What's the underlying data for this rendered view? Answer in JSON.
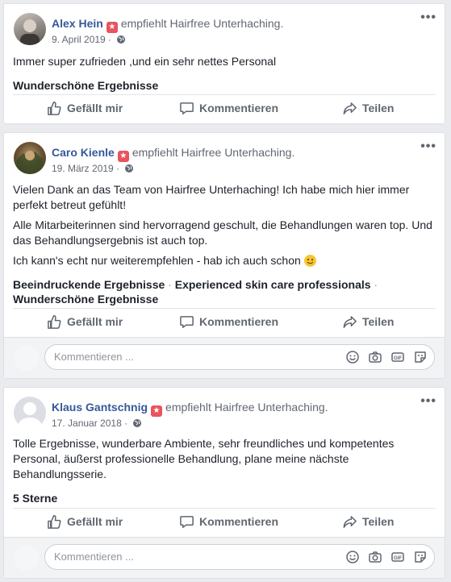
{
  "common": {
    "like_label": "Gefällt mir",
    "comment_label": "Kommentieren",
    "share_label": "Teilen",
    "comment_placeholder": "Kommentieren ...",
    "recommends": "empfiehlt Hairfree Unterhaching.",
    "more": "•••",
    "sep": " · "
  },
  "posts": [
    {
      "author": "Alex Hein",
      "date": "9. April 2019",
      "paragraphs": [
        "Immer super zufrieden ,und ein sehr nettes Personal"
      ],
      "tags": [
        "Wunderschöne Ergebnisse"
      ]
    },
    {
      "author": "Caro Kienle",
      "date": "19. März 2019",
      "paragraphs": [
        "Vielen Dank an das Team von Hairfree Unterhaching! Ich habe mich hier immer perfekt betreut gefühlt!",
        "Alle Mitarbeiterinnen sind hervorragend geschult, die Behandlungen waren top. Und das Behandlungsergebnis ist auch top.",
        "Ich kann's echt nur weiterempfehlen - hab ich auch schon"
      ],
      "tags": [
        "Beeindruckende Ergebnisse",
        "Experienced skin care professionals",
        "Wunderschöne Ergebnisse"
      ]
    },
    {
      "author": "Klaus Gantschnig",
      "date": "17. Januar 2018",
      "paragraphs": [
        "Tolle Ergebnisse, wunderbare Ambiente, sehr freundliches und kompetentes Personal, äußerst professionelle Behandlung, plane meine nächste Behandlungsserie."
      ],
      "tags": [
        "5 Sterne"
      ]
    }
  ],
  "colors": {
    "link": "#365899",
    "badge": "#e9535e",
    "background": "#e9ebee"
  },
  "icons": [
    "like-icon",
    "comment-icon",
    "share-icon",
    "globe-icon",
    "emoji-icon",
    "camera-icon",
    "gif-icon",
    "sticker-icon",
    "recommend-badge-icon"
  ]
}
